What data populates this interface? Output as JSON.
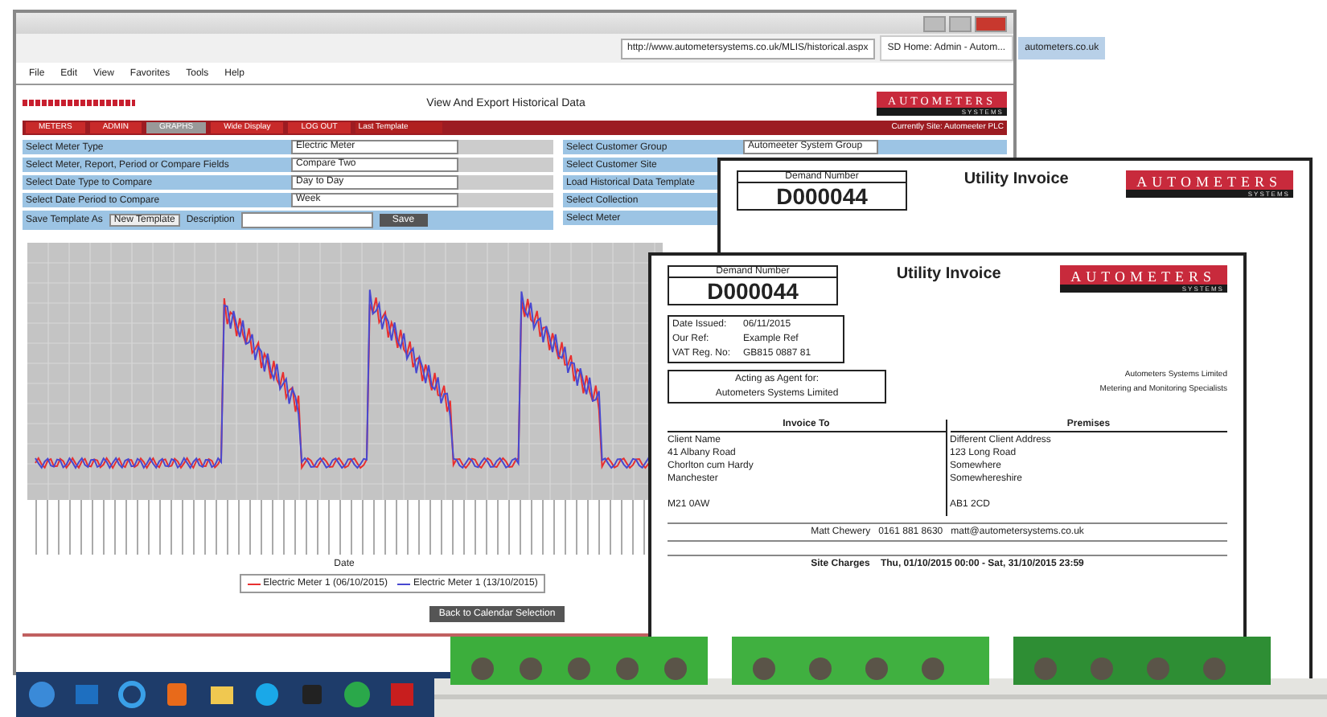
{
  "browser": {
    "url": "http://www.autometersystems.co.uk/MLIS/historical.aspx",
    "tabs": [
      {
        "label": "SD Home: Admin - Autom...",
        "selected": true
      },
      {
        "label": "autometers.co.uk",
        "selected": false
      }
    ],
    "menu": [
      "File",
      "Edit",
      "View",
      "Favorites",
      "Tools",
      "Help"
    ]
  },
  "page": {
    "title": "View And Export Historical Data",
    "logo": {
      "name": "AUTOMETERS",
      "sub": "SYSTEMS"
    },
    "current_site": "Currently Site: Automeeter PLC",
    "nav": [
      {
        "label": "METERS",
        "selected": false
      },
      {
        "label": "ADMIN",
        "selected": false
      },
      {
        "label": "GRAPHS",
        "selected": true
      },
      {
        "label": "Wide Display",
        "selected": false
      },
      {
        "label": "LOG OUT",
        "selected": false
      }
    ],
    "template_select": "Last Template",
    "form_rows": [
      {
        "label": "Select Meter Type",
        "value": "Electric Meter"
      },
      {
        "label": "Select Meter, Report, Period or Compare Fields",
        "value": "Compare Two"
      },
      {
        "label": "Select Date Type to Compare",
        "value": "Day to Day"
      },
      {
        "label": "Select Date Period to Compare",
        "value": "Week"
      }
    ],
    "save_row": {
      "label": "Save Template As",
      "select": "New Template",
      "description_label": "Description",
      "button": "Save"
    },
    "right_rows": [
      {
        "label": "Select Customer Group",
        "value": "Automeeter System Group"
      },
      {
        "label": "Select Customer Site"
      },
      {
        "label": "Load Historical Data Template"
      },
      {
        "label": "Select Collection"
      },
      {
        "label": "Select Meter"
      }
    ],
    "chart": {
      "xlabel": "Date",
      "legend": [
        {
          "name": "Electric Meter 1 (06/10/2015)",
          "color": "#e83030"
        },
        {
          "name": "Electric Meter 1 (13/10/2015)",
          "color": "#4848d0"
        }
      ]
    },
    "back_button": "Back to Calendar Selection"
  },
  "invoice_back": {
    "number_label": "Demand Number",
    "number": "D000044",
    "title": "Utility Invoice",
    "logo": {
      "name": "AUTOMETERS",
      "sub": "SYSTEMS"
    }
  },
  "invoice_front": {
    "number_label": "Demand Number",
    "number": "D000044",
    "title": "Utility Invoice",
    "logo": {
      "name": "AUTOMETERS",
      "sub": "SYSTEMS"
    },
    "details": [
      {
        "key": "Date Issued:",
        "value": "06/11/2015"
      },
      {
        "key": "Our Ref:",
        "value": "Example Ref"
      },
      {
        "key": "VAT Reg. No:",
        "value": "GB815 0887 81"
      }
    ],
    "agent": [
      "Acting as Agent for:",
      "Autometers Systems Limited"
    ],
    "company": [
      "Autometers Systems Limited",
      "Metering and Monitoring Specialists"
    ],
    "invoice_to": {
      "heading": "Invoice To",
      "lines": [
        "Client Name",
        "41 Albany Road",
        "Chorlton cum Hardy",
        "Manchester"
      ],
      "postcode": "M21 0AW"
    },
    "premises": {
      "heading": "Premises",
      "lines": [
        "Different Client Address",
        "123 Long Road",
        "Somewhere",
        "Somewhereshire"
      ],
      "postcode": "AB1 2CD"
    },
    "contact": "Matt Chewery   0161 881 8630   matt@autometersystems.co.uk",
    "charges": "Site Charges    Thu, 01/10/2015 00:00 - Sat, 31/10/2015 23:59"
  },
  "taskbar": [
    {
      "kind": "start"
    },
    {
      "kind": "mail"
    },
    {
      "kind": "browser"
    },
    {
      "kind": "media"
    },
    {
      "kind": "folder"
    },
    {
      "kind": "chat"
    },
    {
      "kind": "app"
    },
    {
      "kind": "green"
    },
    {
      "kind": "pdf"
    }
  ]
}
